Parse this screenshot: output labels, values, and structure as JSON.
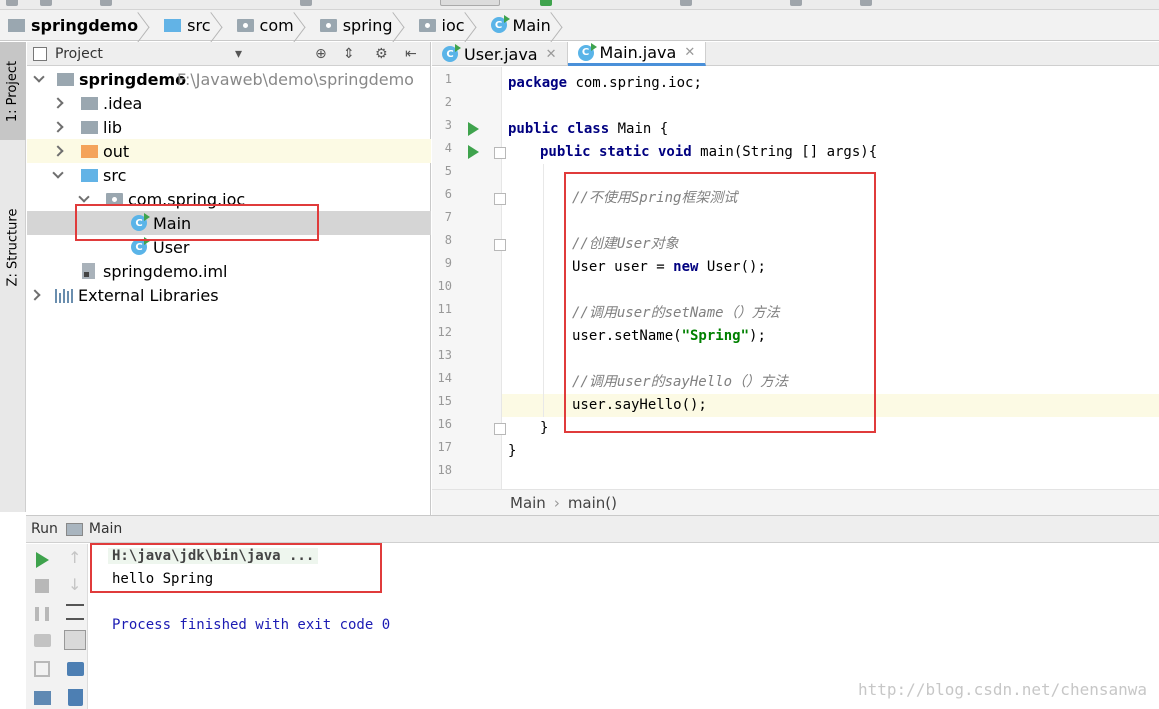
{
  "navbar": {
    "crumbs": [
      "springdemo",
      "src",
      "com",
      "spring",
      "ioc",
      "Main"
    ]
  },
  "left_strip": {
    "project_tab": "1: Project",
    "structure_tab": "Z: Structure"
  },
  "project": {
    "header_label": "Project",
    "tree": {
      "root_name": "springdemo",
      "root_path": "F:\\Javaweb\\demo\\springdemo",
      "idea": ".idea",
      "lib": "lib",
      "out": "out",
      "src": "src",
      "package": "com.spring.ioc",
      "main_class": "Main",
      "user_class": "User",
      "iml": "springdemo.iml",
      "external": "External Libraries"
    }
  },
  "editor": {
    "tabs": [
      {
        "label": "User.java"
      },
      {
        "label": "Main.java"
      }
    ],
    "line_numbers": [
      "1",
      "2",
      "3",
      "4",
      "5",
      "6",
      "7",
      "8",
      "9",
      "10",
      "11",
      "12",
      "13",
      "14",
      "15",
      "16",
      "17",
      "18"
    ],
    "code": {
      "l1_kw": "package",
      "l1_rest": " com.spring.ioc;",
      "l3_kw": "public class",
      "l3_rest": " Main {",
      "l4_kw": "public static void",
      "l4_rest": " main(String [] args){",
      "l6": "//不使用Spring框架测试",
      "l8": "//创建User对象",
      "l9_a": "User user = ",
      "l9_kw": "new",
      "l9_b": " User();",
      "l11": "//调用user的setName（）方法",
      "l12_a": "user.setName(",
      "l12_str": "\"Spring\"",
      "l12_b": ");",
      "l14": "//调用user的sayHello（）方法",
      "l15": "user.sayHello();",
      "l16": "}",
      "l17": "}"
    },
    "crumbs": [
      "Main",
      "main()"
    ]
  },
  "run": {
    "label": "Run",
    "config": "Main",
    "console": {
      "command": "H:\\java\\jdk\\bin\\java ...",
      "output": "hello Spring",
      "exit": "Process finished with exit code 0"
    }
  },
  "watermark": "http://blog.csdn.net/chensanwa",
  "colors": {
    "annotation_red": "#e03b3b",
    "run_green": "#3fa34d",
    "keyword_navy": "#000080",
    "string_green": "#008000"
  }
}
